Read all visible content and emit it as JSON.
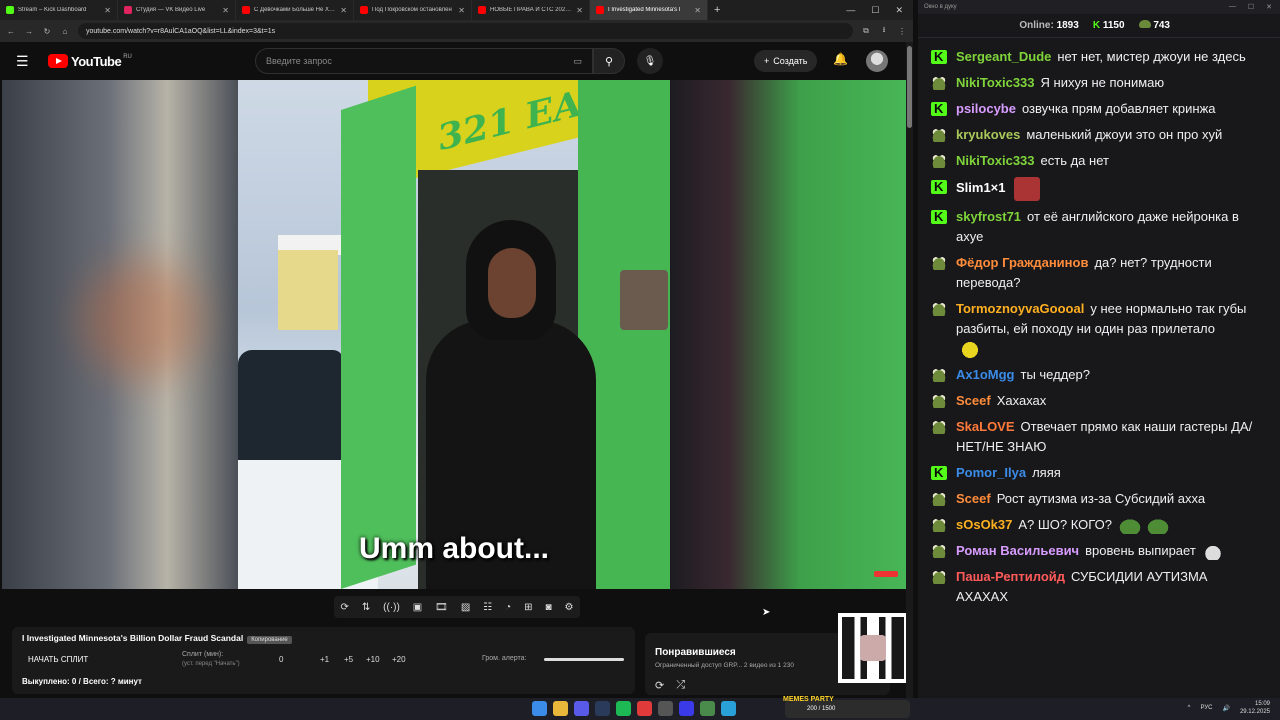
{
  "browser": {
    "tabs": [
      {
        "title": "Stream – Kick Dashboard",
        "color": "#53fc18"
      },
      {
        "title": "Студия — VK Видео Live",
        "color": "#e0245e"
      },
      {
        "title": "С Девочками Больше Не Хочу",
        "color": "#ff0000"
      },
      {
        "title": "Под Покровском остановлен",
        "color": "#ff0000"
      },
      {
        "title": "НОВЫЕ ПРАВА И СТС 2026! н",
        "color": "#ff0000"
      },
      {
        "title": "I Investigated Minnesota's I",
        "color": "#ff0000"
      }
    ],
    "url": "youtube.com/watch?v=r8AulCA1aOQ&list=LL&index=3&t=1s"
  },
  "youtube": {
    "logo_text": "YouTube",
    "region": "RU",
    "search_placeholder": "Введите запрос",
    "create_label": "Создать"
  },
  "video": {
    "subtitle": "Umm about...",
    "sign_text": "321 EA"
  },
  "split_panel": {
    "title": "I Investigated Minnesota's Billion Dollar Fraud Scandal",
    "tag": "Копирование",
    "start_label": "НАЧАТЬ СПЛИТ",
    "split_label": "Сплит (мин):",
    "split_hint": "(уст. перед \"Начать\")",
    "split_value": "0",
    "increments": [
      "+1",
      "+5",
      "+10",
      "+20"
    ],
    "volume_label": "Гром. алерта:",
    "footer": "Выкуплено: 0 / Всего: ? минут"
  },
  "liked_panel": {
    "title": "Понравившиеся",
    "subtitle": "Ограниченный доступ  GRP...    2 видео из 1 230"
  },
  "chat": {
    "window_title": "Окно в дуку",
    "online_label": "Online:",
    "online_count": "1893",
    "kick_count": "1150",
    "frog_count": "743",
    "messages": [
      {
        "user": "Sergeant_Dude",
        "color": "#7fd43a",
        "badge": "kick",
        "text": "нет нет, мистер джоуи не здесь"
      },
      {
        "user": "NikiToxic333",
        "color": "#7fd43a",
        "badge": "frog",
        "text": "Я нихуя не понимаю"
      },
      {
        "user": "psilocybe",
        "color": "#d89cff",
        "badge": "kick",
        "text": "озвучка прям добавляет кринжа"
      },
      {
        "user": "kryukoves",
        "color": "#a8c85a",
        "badge": "frog",
        "text": "маленький джоуи это он про хуй"
      },
      {
        "user": "NikiToxic333",
        "color": "#7fd43a",
        "badge": "frog",
        "text": "есть да нет"
      },
      {
        "user": "Slim1×1",
        "color": "#ffffff",
        "badge": "kick",
        "text": ""
      },
      {
        "user": "skyfrost71",
        "color": "#7fd43a",
        "badge": "kick",
        "text": "от её английского даже нейронка в ахуе"
      },
      {
        "user": "Фёдор Гражданинов",
        "color": "#ff8c3a",
        "badge": "frog",
        "text": "да? нет? трудности перевода?"
      },
      {
        "user": "TormoznoyvaGoooal",
        "color": "#ffb020",
        "badge": "frog",
        "text": "у нее нормально так губы разбиты, ей походу ни один раз прилетало"
      },
      {
        "user": "Ax1oMgg",
        "color": "#3a8ce8",
        "badge": "frog",
        "text": "ты чеддер?"
      },
      {
        "user": "Sceef",
        "color": "#ff8c3a",
        "badge": "frog",
        "text": "Хахахах"
      },
      {
        "user": "SkaLOVE",
        "color": "#ff7a3a",
        "badge": "frog",
        "text": "Отвечает прямо как наши гастеры ДА/НЕТ/НЕ ЗНАЮ"
      },
      {
        "user": "Pomor_Ilya",
        "color": "#3a8ce8",
        "badge": "kick",
        "text": "ляяя"
      },
      {
        "user": "Sceef",
        "color": "#ff8c3a",
        "badge": "frog",
        "text": "Рост аутизма из-за Субсидий ахха"
      },
      {
        "user": "sOsOk37",
        "color": "#ffb020",
        "badge": "frog",
        "text": "А?  ШО?  КОГО?"
      },
      {
        "user": "Роман Васильевич",
        "color": "#d89cff",
        "badge": "frog",
        "text": "вровень выпирает"
      },
      {
        "user": "Паша-Рептилойд",
        "color": "#ff5a5a",
        "badge": "frog",
        "text": "СУБСИДИИ АУТИЗМА АХАХАХ"
      }
    ]
  },
  "taskbar": {
    "memes_label": "MEMES PARTY",
    "memes_count": "200 / 1500",
    "lang": "РУС",
    "time": "15:09",
    "date": "29.12.2025"
  }
}
